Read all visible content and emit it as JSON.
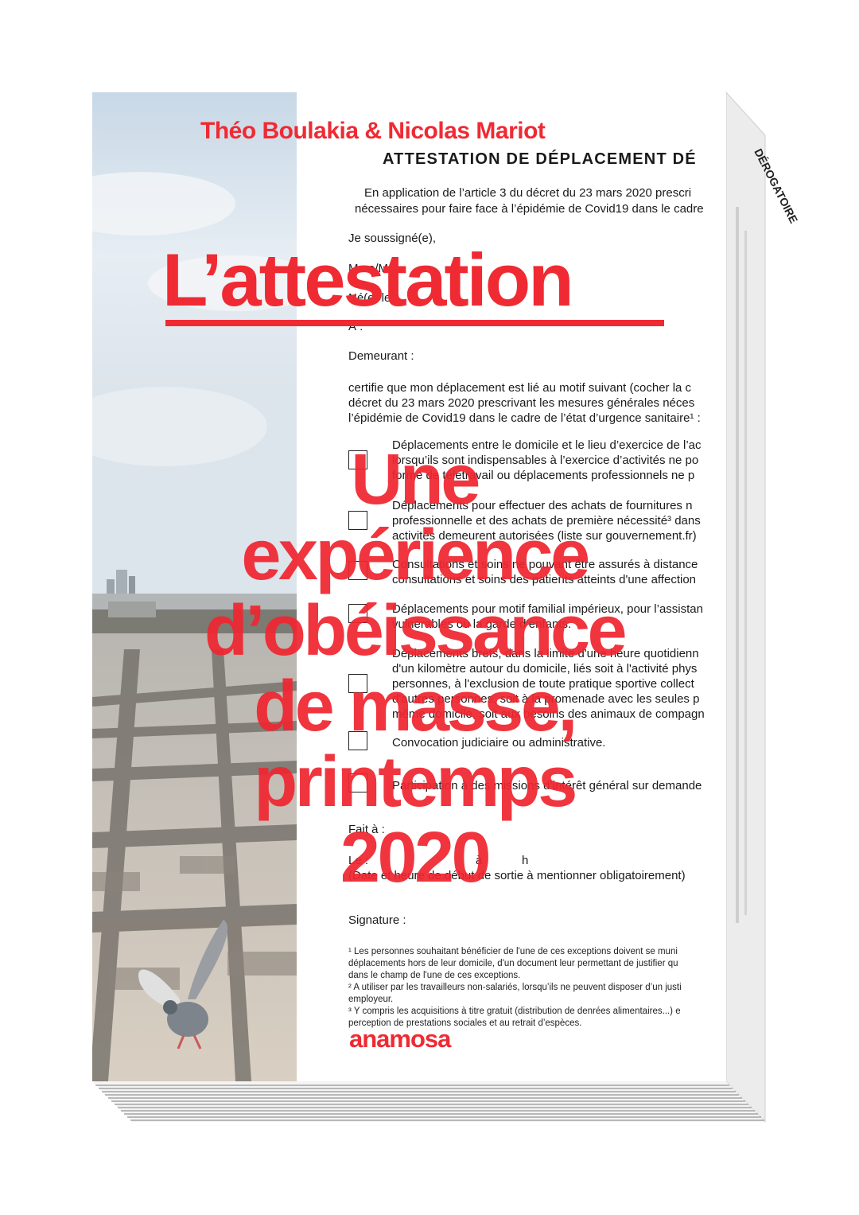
{
  "book": {
    "authors": "Théo Boulakia & Nicolas Mariot",
    "title": "L’attestation",
    "subtitle_lines": [
      "Une",
      "expérience",
      "d’obéissance",
      "de masse,",
      "printemps",
      "2020"
    ],
    "publisher": "anamosa"
  },
  "form": {
    "heading": "ATTESTATION DE DÉPLACEMENT DÉ",
    "intro_1": "En application de l’article 3 du décret du 23 mars 2020 prescri",
    "intro_2": "nécessaires pour faire face à l’épidémie de Covid19 dans le cadre",
    "undersigned": "Je soussigné(e),",
    "field_name": "Mme/M. :",
    "field_born": "Né(e) le :",
    "field_at": "À :",
    "field_residing": "Demeurant :",
    "certify_1": "certifie que mon déplacement est lié au motif suivant (cocher la c",
    "certify_2": "décret du 23 mars 2020 prescrivant les mesures générales néces",
    "certify_3": "l’épidémie de Covid19 dans le cadre de l’état d’urgence sanitaire¹ :",
    "options": [
      "Déplacements entre le domicile et le lieu d’exercice de l’ac\nlorsqu’ils sont indispensables à l’exercice d’activités ne po\nforme de télétravail ou déplacements professionnels ne p",
      "Déplacements pour effectuer des achats de fournitures n\nprofessionnelle et des achats de première nécessité³ dans\nactivités demeurent autorisées (liste sur gouvernement.fr)",
      "Consultations et soins ne pouvant être assurés à distance\nconsultations et soins des patients atteints d'une affection",
      "Déplacements pour motif familial impérieux, pour l’assistan\nvulnérables ou la garde d’enfants.",
      "Déplacements brefs, dans la limite d'une heure quotidienn\nd'un kilomètre autour du domicile, liés soit à l'activité phys\npersonnes, à l'exclusion de toute pratique sportive collect\nd'autres personnes, soit à la promenade avec les seules p\nmême domicile, soit aux besoins des animaux de compagn",
      "Convocation judiciaire ou administrative.",
      "Participation à des missions d’intérêt général sur demande"
    ],
    "made_at": "Fait à :",
    "date_label": "Le :",
    "at_label": "à",
    "hour_label": "h",
    "date_note": "(Date et heure de début de sortie à mentionner obligatoirement)",
    "signature": "Signature :",
    "footnotes": "¹ Les personnes souhaitant bénéficier de l'une de ces exceptions doivent se muni\ndéplacements hors de leur domicile, d'un document leur permettant de justifier qu\ndans le champ de l'une de ces exceptions.\n² A utiliser par les travailleurs non-salariés, lorsqu’ils ne peuvent disposer d’un justi\nemployeur.\n³ Y compris les acquisitions à titre gratuit (distribution de denrées alimentaires...) e\nperception de prestations sociales et au retrait d’espèces."
  },
  "side_text": "DÉROGATOIRE",
  "colors": {
    "accent": "#ef2a33",
    "paper": "#ffffff",
    "ink": "#1a1a1a"
  }
}
